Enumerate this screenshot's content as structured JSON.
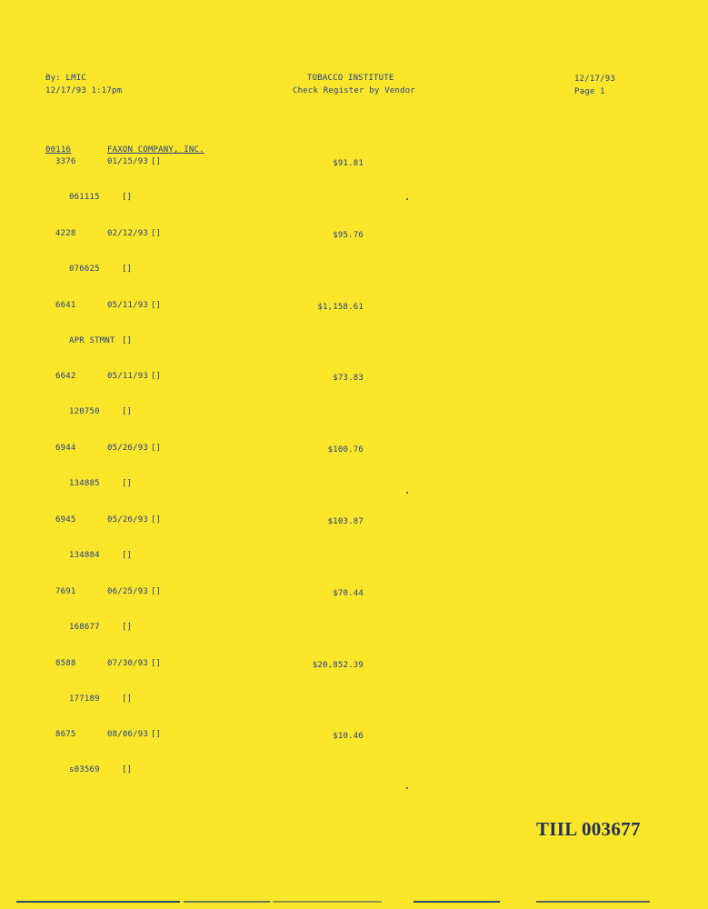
{
  "header": {
    "by": "By: LMIC",
    "datetime": "12/17/93  1:17pm",
    "company": "TOBACCO INSTITUTE",
    "report_title": "Check Register by Vendor",
    "date": "12/17/93",
    "page": "Page   1"
  },
  "vendor": {
    "code": "00116",
    "name": "FAXON COMPANY, INC."
  },
  "entries": [
    {
      "check": "3376",
      "date": "01/15/93",
      "mark": "[]",
      "amount": "$91.81",
      "ref": "061115",
      "ref_mark": "[]"
    },
    {
      "check": "4228",
      "date": "02/12/93",
      "mark": "[]",
      "amount": "$95.76",
      "ref": "076625",
      "ref_mark": "[]"
    },
    {
      "check": "6641",
      "date": "05/11/93",
      "mark": "[]",
      "amount": "$1,158.61",
      "ref": "APR STMNT",
      "ref_mark": "[]"
    },
    {
      "check": "6642",
      "date": "05/11/93",
      "mark": "[]",
      "amount": "$73.83",
      "ref": "120750",
      "ref_mark": "[]"
    },
    {
      "check": "6944",
      "date": "05/26/93",
      "mark": "[]",
      "amount": "$100.76",
      "ref": "134885",
      "ref_mark": "[]"
    },
    {
      "check": "6945",
      "date": "05/26/93",
      "mark": "[]",
      "amount": "$103.87",
      "ref": "134884",
      "ref_mark": "[]"
    },
    {
      "check": "7691",
      "date": "06/25/93",
      "mark": "[]",
      "amount": "$70.44",
      "ref": "168677",
      "ref_mark": "[]"
    },
    {
      "check": "8588",
      "date": "07/30/93",
      "mark": "[]",
      "amount": "$20,852.39",
      "ref": "177189",
      "ref_mark": "[]"
    },
    {
      "check": "8675",
      "date": "08/06/93",
      "mark": "[]",
      "amount": "$10.46",
      "ref": "s03569",
      "ref_mark": "[]"
    }
  ],
  "stamp": "TIIL 003677"
}
